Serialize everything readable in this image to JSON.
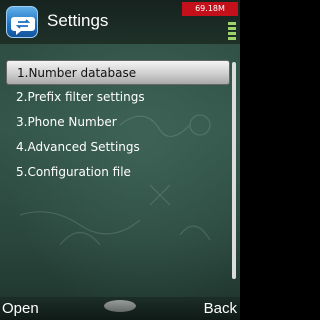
{
  "header": {
    "title": "Settings",
    "app_icon": "phone-chat-icon"
  },
  "status": {
    "memory": "69.18M"
  },
  "menu": {
    "items": [
      {
        "label": "1.Number database",
        "selected": true
      },
      {
        "label": "2.Prefix filter settings",
        "selected": false
      },
      {
        "label": "3.Phone Number",
        "selected": false
      },
      {
        "label": "4.Advanced Settings",
        "selected": false
      },
      {
        "label": "5.Configuration file",
        "selected": false
      }
    ]
  },
  "softkeys": {
    "left": "Open",
    "right": "Back"
  },
  "colors": {
    "memory_badge": "#c3101a",
    "background": "#2f5046",
    "selection": "#d8d8d8"
  }
}
